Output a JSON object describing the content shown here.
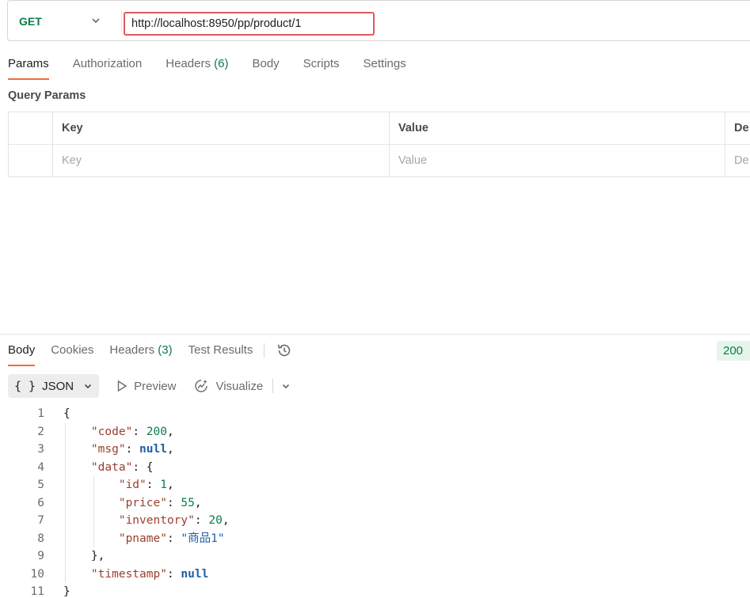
{
  "request": {
    "method": "GET",
    "url": "http://localhost:8950/pp/product/1"
  },
  "request_tabs": [
    {
      "label": "Params",
      "active": true
    },
    {
      "label": "Authorization"
    },
    {
      "label": "Headers",
      "count": "(6)"
    },
    {
      "label": "Body"
    },
    {
      "label": "Scripts"
    },
    {
      "label": "Settings"
    }
  ],
  "query_params": {
    "title": "Query Params",
    "columns": [
      "Key",
      "Value",
      "De"
    ],
    "placeholders": [
      "Key",
      "Value",
      "De"
    ]
  },
  "response": {
    "tabs": [
      {
        "label": "Body",
        "active": true
      },
      {
        "label": "Cookies"
      },
      {
        "label": "Headers",
        "count": "(3)"
      },
      {
        "label": "Test Results"
      }
    ],
    "status": "200",
    "format": "JSON",
    "preview_label": "Preview",
    "visualize_label": "Visualize",
    "lines": [
      [
        [
          "p",
          "{"
        ]
      ],
      [
        [
          "p",
          "    "
        ],
        [
          "k",
          "\"code\""
        ],
        [
          "p",
          ": "
        ],
        [
          "n",
          "200"
        ],
        [
          "p",
          ","
        ]
      ],
      [
        [
          "p",
          "    "
        ],
        [
          "k",
          "\"msg\""
        ],
        [
          "p",
          ": "
        ],
        [
          "nl",
          "null"
        ],
        [
          "p",
          ","
        ]
      ],
      [
        [
          "p",
          "    "
        ],
        [
          "k",
          "\"data\""
        ],
        [
          "p",
          ": {"
        ]
      ],
      [
        [
          "p",
          "        "
        ],
        [
          "k",
          "\"id\""
        ],
        [
          "p",
          ": "
        ],
        [
          "n",
          "1"
        ],
        [
          "p",
          ","
        ]
      ],
      [
        [
          "p",
          "        "
        ],
        [
          "k",
          "\"price\""
        ],
        [
          "p",
          ": "
        ],
        [
          "n",
          "55"
        ],
        [
          "p",
          ","
        ]
      ],
      [
        [
          "p",
          "        "
        ],
        [
          "k",
          "\"inventory\""
        ],
        [
          "p",
          ": "
        ],
        [
          "n",
          "20"
        ],
        [
          "p",
          ","
        ]
      ],
      [
        [
          "p",
          "        "
        ],
        [
          "k",
          "\"pname\""
        ],
        [
          "p",
          ": "
        ],
        [
          "s",
          "\"商品1\""
        ]
      ],
      [
        [
          "p",
          "    },"
        ]
      ],
      [
        [
          "p",
          "    "
        ],
        [
          "k",
          "\"timestamp\""
        ],
        [
          "p",
          ": "
        ],
        [
          "nl",
          "null"
        ]
      ],
      [
        [
          "p",
          "}"
        ]
      ]
    ]
  },
  "colors": {
    "accent": "#f26b3a",
    "method_get": "#0a7d47",
    "url_highlight": "#e05a5a",
    "json_key": "#9c3e2a",
    "json_number": "#0a7d47",
    "json_string_null": "#1f5fa6"
  }
}
